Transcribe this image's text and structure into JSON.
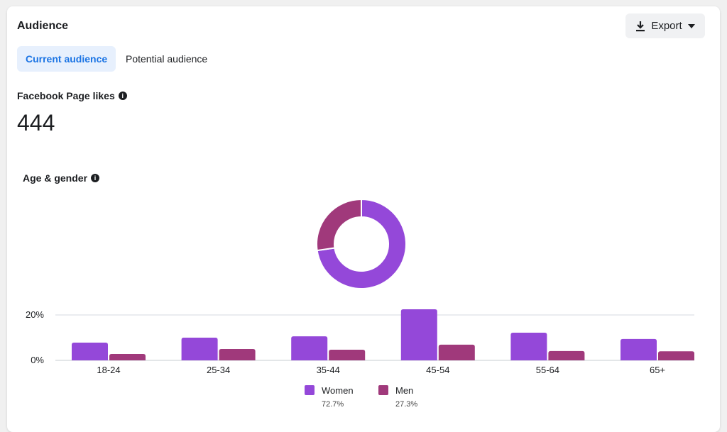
{
  "header": {
    "title": "Audience",
    "export_label": "Export"
  },
  "tabs": [
    {
      "label": "Current audience",
      "active": true
    },
    {
      "label": "Potential audience",
      "active": false
    }
  ],
  "likes": {
    "label": "Facebook Page likes",
    "value": "444"
  },
  "section_label": "Age & gender",
  "colors": {
    "women": "#9448d9",
    "men": "#a0397b"
  },
  "chart_data": {
    "type": "bar",
    "categories": [
      "18-24",
      "25-34",
      "35-44",
      "45-54",
      "55-64",
      "65+"
    ],
    "series": [
      {
        "name": "Women",
        "total": "72.7%",
        "values": [
          7.8,
          10.0,
          10.6,
          22.5,
          12.2,
          9.4
        ]
      },
      {
        "name": "Men",
        "total": "27.3%",
        "values": [
          2.8,
          5.0,
          4.7,
          6.9,
          4.1,
          4.0
        ]
      }
    ],
    "yticks": [
      "0%",
      "20%"
    ],
    "ylim": [
      0,
      20
    ],
    "donut": [
      {
        "name": "Women",
        "value": 72.7
      },
      {
        "name": "Men",
        "value": 27.3
      }
    ],
    "grid": true,
    "legend": "bottom"
  }
}
